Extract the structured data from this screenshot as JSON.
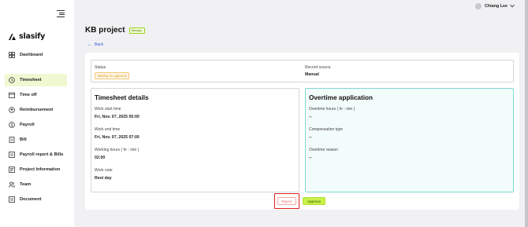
{
  "brand": {
    "name": "slasify"
  },
  "sidebar": {
    "items": [
      {
        "label": "Dashboard",
        "icon": "dashboard-icon"
      },
      {
        "label": "Timesheet",
        "icon": "clock-icon",
        "active": true
      },
      {
        "label": "Time off",
        "icon": "calendar-icon"
      },
      {
        "label": "Reimbursement",
        "icon": "refund-icon"
      },
      {
        "label": "Payroll",
        "icon": "money-icon"
      },
      {
        "label": "Bill",
        "icon": "bill-icon"
      },
      {
        "label": "Payroll report & Bills",
        "icon": "report-icon"
      },
      {
        "label": "Project Information",
        "icon": "project-icon"
      },
      {
        "label": "Team",
        "icon": "team-icon"
      },
      {
        "label": "Document",
        "icon": "document-icon"
      }
    ]
  },
  "header": {
    "user_name": "Chiang Lee"
  },
  "page": {
    "title": "KB project",
    "role_badge": "Manager",
    "back_label": "Back"
  },
  "status_section": {
    "status_label": "Status",
    "status_value": "Waiting for approval",
    "record_source_label": "Record source",
    "record_source_value": "Manual"
  },
  "timesheet": {
    "title": "Timesheet details",
    "fields": [
      {
        "label": "Work start time",
        "value": "Fri, Nov. 07, 2025 05:00"
      },
      {
        "label": "Work end time",
        "value": "Fri, Nov. 07, 2025 07:00"
      },
      {
        "label": "Working hours ( hr : min )",
        "value": "02:00"
      },
      {
        "label": "Work note",
        "value": "Rest day"
      }
    ]
  },
  "overtime": {
    "title": "Overtime application",
    "fields": [
      {
        "label": "Overtime hours ( hr : min )",
        "value": "--"
      },
      {
        "label": "Compensation type",
        "value": "--"
      },
      {
        "label": "Overtime reason",
        "value": "--"
      }
    ]
  },
  "actions": {
    "reject_label": "Reject",
    "approve_label": "Approve"
  },
  "colors": {
    "accent_lime": "#c9f14a",
    "active_nav_bg": "#eef9d2",
    "overtime_border": "#7fd9cf",
    "highlight_red": "#e02020",
    "link_blue": "#3a5bd6",
    "status_orange": "#e39a19"
  }
}
